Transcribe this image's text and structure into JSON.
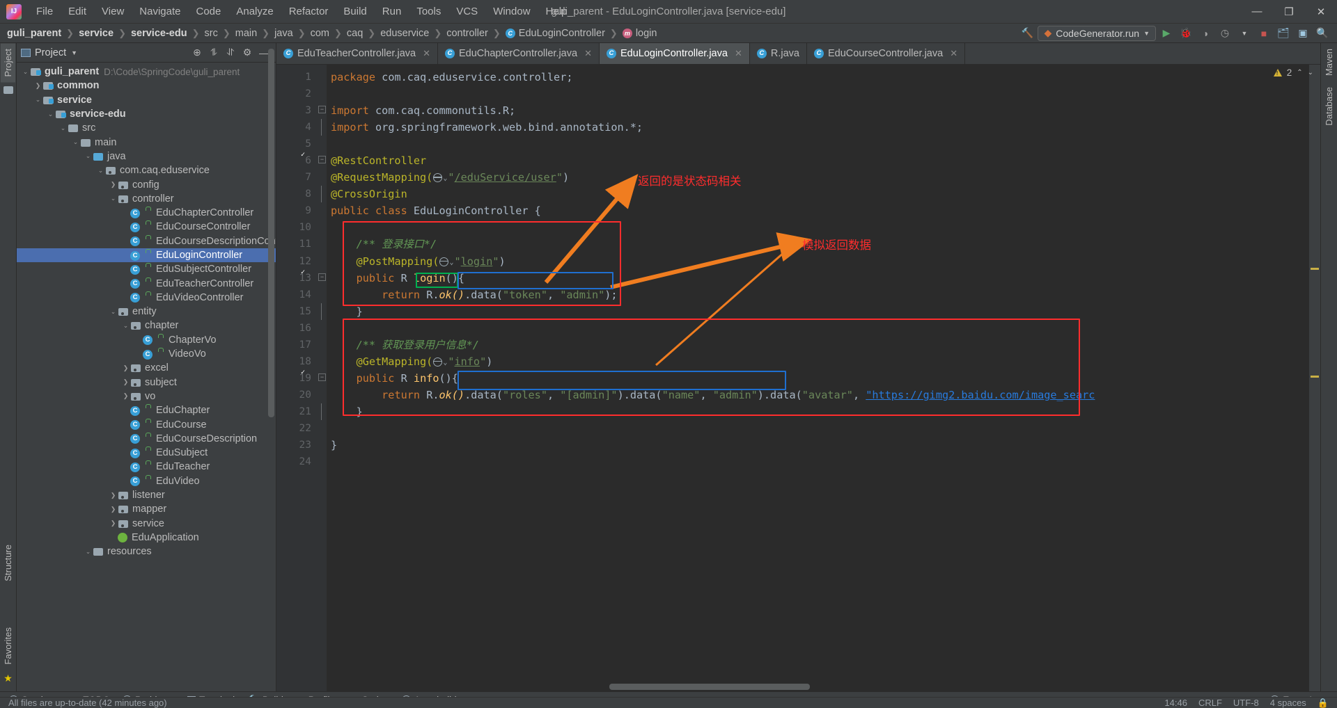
{
  "window": {
    "title": "guli_parent - EduLoginController.java [service-edu]",
    "minimize": "—",
    "maximize": "❐",
    "close": "✕"
  },
  "menubar": [
    {
      "label": "File"
    },
    {
      "label": "Edit"
    },
    {
      "label": "View"
    },
    {
      "label": "Navigate"
    },
    {
      "label": "Code"
    },
    {
      "label": "Analyze"
    },
    {
      "label": "Refactor"
    },
    {
      "label": "Build"
    },
    {
      "label": "Run"
    },
    {
      "label": "Tools"
    },
    {
      "label": "VCS"
    },
    {
      "label": "Window"
    },
    {
      "label": "Help"
    }
  ],
  "breadcrumb": [
    {
      "label": "guli_parent",
      "bold": true
    },
    {
      "label": "service",
      "bold": true
    },
    {
      "label": "service-edu",
      "bold": true
    },
    {
      "label": "src"
    },
    {
      "label": "main"
    },
    {
      "label": "java"
    },
    {
      "label": "com"
    },
    {
      "label": "caq"
    },
    {
      "label": "eduservice"
    },
    {
      "label": "controller"
    },
    {
      "label": "EduLoginController",
      "icon": "class-icon"
    },
    {
      "label": "login",
      "icon": "method-icon"
    }
  ],
  "toolbar": {
    "run_config": "CodeGenerator.run",
    "build_icon": "hammer-icon",
    "run_icon": "run-triangle-icon",
    "debug_icon": "debug-bug-icon",
    "coverage_icon": "coverage-icon",
    "profiler_icon": "profiler-clock-icon",
    "stop_icon": "stop-square-icon",
    "updates_icon": "update-folder-icon",
    "layout_icon": "layout-icon",
    "search_icon": "search-icon"
  },
  "left_strip": {
    "project_tab": "Project",
    "structure_tab": "Structure",
    "favorites_tab": "Favorites"
  },
  "right_strip": {
    "maven_tab": "Maven",
    "database_tab": "Database"
  },
  "project_panel": {
    "title": "Project",
    "icons": [
      "locate-icon",
      "collapse-all-icon",
      "expand-all-icon",
      "settings-gear-icon",
      "hide-icon"
    ],
    "tree": [
      {
        "depth": 0,
        "twist": "v",
        "icon": "module-folder",
        "label": "guli_parent",
        "bold": true,
        "path": "D:\\Code\\SpringCode\\guli_parent"
      },
      {
        "depth": 1,
        "twist": ">",
        "icon": "module-folder",
        "label": "common",
        "bold": true
      },
      {
        "depth": 1,
        "twist": "v",
        "icon": "module-folder",
        "label": "service",
        "bold": true
      },
      {
        "depth": 2,
        "twist": "v",
        "icon": "module-folder",
        "label": "service-edu",
        "bold": true
      },
      {
        "depth": 3,
        "twist": "v",
        "icon": "folder",
        "label": "src"
      },
      {
        "depth": 4,
        "twist": "v",
        "icon": "folder",
        "label": "main"
      },
      {
        "depth": 5,
        "twist": "v",
        "icon": "src-folder",
        "label": "java"
      },
      {
        "depth": 6,
        "twist": "v",
        "icon": "package",
        "label": "com.caq.eduservice"
      },
      {
        "depth": 7,
        "twist": ">",
        "icon": "package",
        "label": "config"
      },
      {
        "depth": 7,
        "twist": "v",
        "icon": "package",
        "label": "controller"
      },
      {
        "depth": 8,
        "twist": "",
        "icon": "class",
        "label": "EduChapterController"
      },
      {
        "depth": 8,
        "twist": "",
        "icon": "class",
        "label": "EduCourseController"
      },
      {
        "depth": 8,
        "twist": "",
        "icon": "class",
        "label": "EduCourseDescriptionController"
      },
      {
        "depth": 8,
        "twist": "",
        "icon": "class",
        "label": "EduLoginController",
        "selected": true
      },
      {
        "depth": 8,
        "twist": "",
        "icon": "class",
        "label": "EduSubjectController"
      },
      {
        "depth": 8,
        "twist": "",
        "icon": "class",
        "label": "EduTeacherController"
      },
      {
        "depth": 8,
        "twist": "",
        "icon": "class",
        "label": "EduVideoController"
      },
      {
        "depth": 7,
        "twist": "v",
        "icon": "package",
        "label": "entity"
      },
      {
        "depth": 8,
        "twist": "v",
        "icon": "package",
        "label": "chapter"
      },
      {
        "depth": 9,
        "twist": "",
        "icon": "class",
        "label": "ChapterVo"
      },
      {
        "depth": 9,
        "twist": "",
        "icon": "class",
        "label": "VideoVo"
      },
      {
        "depth": 8,
        "twist": ">",
        "icon": "package",
        "label": "excel"
      },
      {
        "depth": 8,
        "twist": ">",
        "icon": "package",
        "label": "subject"
      },
      {
        "depth": 8,
        "twist": ">",
        "icon": "package",
        "label": "vo"
      },
      {
        "depth": 8,
        "twist": "",
        "icon": "class",
        "label": "EduChapter"
      },
      {
        "depth": 8,
        "twist": "",
        "icon": "class",
        "label": "EduCourse"
      },
      {
        "depth": 8,
        "twist": "",
        "icon": "class",
        "label": "EduCourseDescription"
      },
      {
        "depth": 8,
        "twist": "",
        "icon": "class",
        "label": "EduSubject"
      },
      {
        "depth": 8,
        "twist": "",
        "icon": "class",
        "label": "EduTeacher"
      },
      {
        "depth": 8,
        "twist": "",
        "icon": "class",
        "label": "EduVideo"
      },
      {
        "depth": 7,
        "twist": ">",
        "icon": "package",
        "label": "listener"
      },
      {
        "depth": 7,
        "twist": ">",
        "icon": "package",
        "label": "mapper"
      },
      {
        "depth": 7,
        "twist": ">",
        "icon": "package",
        "label": "service"
      },
      {
        "depth": 7,
        "twist": "",
        "icon": "spring",
        "label": "EduApplication"
      },
      {
        "depth": 5,
        "twist": "v",
        "icon": "folder",
        "label": "resources"
      }
    ]
  },
  "tabs": [
    {
      "label": "EduTeacherController.java",
      "active": false
    },
    {
      "label": "EduChapterController.java",
      "active": false
    },
    {
      "label": "EduLoginController.java",
      "active": true
    },
    {
      "label": "R.java",
      "active": false
    },
    {
      "label": "EduCourseController.java",
      "active": false
    }
  ],
  "inspection": {
    "warning_count": "2"
  },
  "code": {
    "filename": "EduLoginController.java",
    "lines": [
      {
        "n": "1",
        "gutter_icon": "",
        "fold": "",
        "text": "package com.caq.eduservice.controller;"
      },
      {
        "n": "2",
        "gutter_icon": "",
        "fold": "",
        "text": ""
      },
      {
        "n": "3",
        "gutter_icon": "",
        "fold": "minus",
        "text": "import com.caq.commonutils.R;"
      },
      {
        "n": "4",
        "gutter_icon": "",
        "fold": "end",
        "text": "import org.springframework.web.bind.annotation.*;"
      },
      {
        "n": "5",
        "gutter_icon": "",
        "fold": "",
        "text": ""
      },
      {
        "n": "6",
        "gutter_icon": "green-check",
        "fold": "minus",
        "text": "@RestController"
      },
      {
        "n": "7",
        "gutter_icon": "",
        "fold": "",
        "text": "@RequestMapping(\"/eduService/user\")"
      },
      {
        "n": "8",
        "gutter_icon": "",
        "fold": "end",
        "text": "@CrossOrigin"
      },
      {
        "n": "9",
        "gutter_icon": "spring",
        "fold": "",
        "text": "public class EduLoginController {"
      },
      {
        "n": "10",
        "gutter_icon": "",
        "fold": "",
        "text": ""
      },
      {
        "n": "11",
        "gutter_icon": "",
        "fold": "",
        "text": "    /** 登录接口*/"
      },
      {
        "n": "12",
        "gutter_icon": "",
        "fold": "",
        "text": "    @PostMapping(\"login\")"
      },
      {
        "n": "13",
        "gutter_icon": "green-check",
        "fold": "minus",
        "text": "    public R login(){"
      },
      {
        "n": "14",
        "gutter_icon": "",
        "fold": "",
        "text": "        return R.ok().data(\"token\", \"admin\");"
      },
      {
        "n": "15",
        "gutter_icon": "",
        "fold": "end",
        "text": "    }"
      },
      {
        "n": "16",
        "gutter_icon": "",
        "fold": "",
        "text": ""
      },
      {
        "n": "17",
        "gutter_icon": "",
        "fold": "",
        "text": "    /** 获取登录用户信息*/"
      },
      {
        "n": "18",
        "gutter_icon": "",
        "fold": "",
        "text": "    @GetMapping(\"info\")"
      },
      {
        "n": "19",
        "gutter_icon": "green-check",
        "fold": "minus",
        "text": "    public R info(){"
      },
      {
        "n": "20",
        "gutter_icon": "",
        "fold": "",
        "text": "        return R.ok().data(\"roles\", \"[admin]\").data(\"name\", \"admin\").data(\"avatar\", \"https://gimg2.baidu.com/image_searc"
      },
      {
        "n": "21",
        "gutter_icon": "",
        "fold": "end",
        "text": "    }"
      },
      {
        "n": "22",
        "gutter_icon": "",
        "fold": "",
        "text": ""
      },
      {
        "n": "23",
        "gutter_icon": "",
        "fold": "",
        "text": "}"
      },
      {
        "n": "24",
        "gutter_icon": "",
        "fold": "",
        "text": ""
      }
    ],
    "strings": {
      "package_kw": "package",
      "import_kw": "import",
      "public_kw": "public",
      "class_kw": "class",
      "return_kw": "return",
      "pkg_name": "com.caq.eduservice.controller;",
      "import1": "com.caq.commonutils.R;",
      "import2": "org.springframework.web.bind.annotation.*;",
      "ann_rest": "@RestController",
      "ann_reqmap": "@RequestMapping(",
      "url_eduservice": "/eduService/user",
      "ann_cross": "@CrossOrigin",
      "class_name": "EduLoginController",
      "comment_login": "/** 登录接口*/",
      "ann_post": "@PostMapping(",
      "url_login": "login",
      "m_login": "login",
      "r_type": "R",
      "ok_call": "ok()",
      "data_call": ".data(",
      "s_token": "\"token\"",
      "s_admin": "\"admin\"",
      "comment_info": "/** 获取登录用户信息*/",
      "ann_get": "@GetMapping(",
      "url_info": "info",
      "m_info": "info",
      "s_roles": "\"roles\"",
      "s_adminarr": "\"[admin]\"",
      "s_name": "\"name\"",
      "s_avatar": "\"avatar\"",
      "s_url": "\"https://gimg2.baidu.com/image_searc"
    }
  },
  "annotations": {
    "note_status": "返回的是状态码相关",
    "note_mock": "模拟返回数据",
    "box_colors": {
      "red": "#ff2d2d",
      "green": "#00b050",
      "blue": "#1f6fd0",
      "arrow": "#f07d20"
    }
  },
  "statusbar": {
    "left_items": [
      {
        "label": "Services",
        "icon": "services-icon"
      },
      {
        "label": "TODO",
        "icon": "todo-icon"
      },
      {
        "label": "Problems",
        "icon": "problems-icon"
      },
      {
        "label": "Terminal",
        "icon": "terminal-icon"
      },
      {
        "label": "Build",
        "icon": "build-hammer-icon"
      },
      {
        "label": "Profiler",
        "icon": "profiler-icon"
      },
      {
        "label": "Spring",
        "icon": "spring-leaf-icon"
      },
      {
        "label": "Auto-build",
        "icon": "auto-build-icon"
      }
    ],
    "event_log": "Event Log",
    "message": "All files are up-to-date (42 minutes ago)",
    "caret": "14:46",
    "line_sep": "CRLF",
    "encoding": "UTF-8",
    "indent": "4 spaces",
    "lock": "lock-icon"
  }
}
